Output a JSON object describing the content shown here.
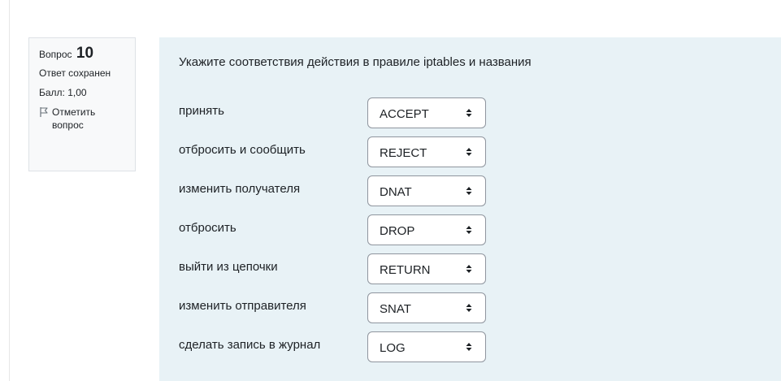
{
  "info": {
    "question_label": "Вопрос",
    "question_number": "10",
    "status": "Ответ сохранен",
    "mark": "Балл: 1,00",
    "flag_label": "Отметить вопрос"
  },
  "question": {
    "text": "Укажите соответствия действия в правиле iptables и названия",
    "rows": [
      {
        "label": "принять",
        "selected": "ACCEPT"
      },
      {
        "label": "отбросить и сообщить",
        "selected": "REJECT"
      },
      {
        "label": "изменить получателя",
        "selected": "DNAT"
      },
      {
        "label": "отбросить",
        "selected": "DROP"
      },
      {
        "label": "выйти из цепочки",
        "selected": "RETURN"
      },
      {
        "label": "изменить отправителя",
        "selected": "SNAT"
      },
      {
        "label": "сделать запись в журнал",
        "selected": "LOG"
      }
    ]
  },
  "icons": {
    "flag": "flag-icon",
    "select_arrow": "sort-arrows-icon"
  }
}
